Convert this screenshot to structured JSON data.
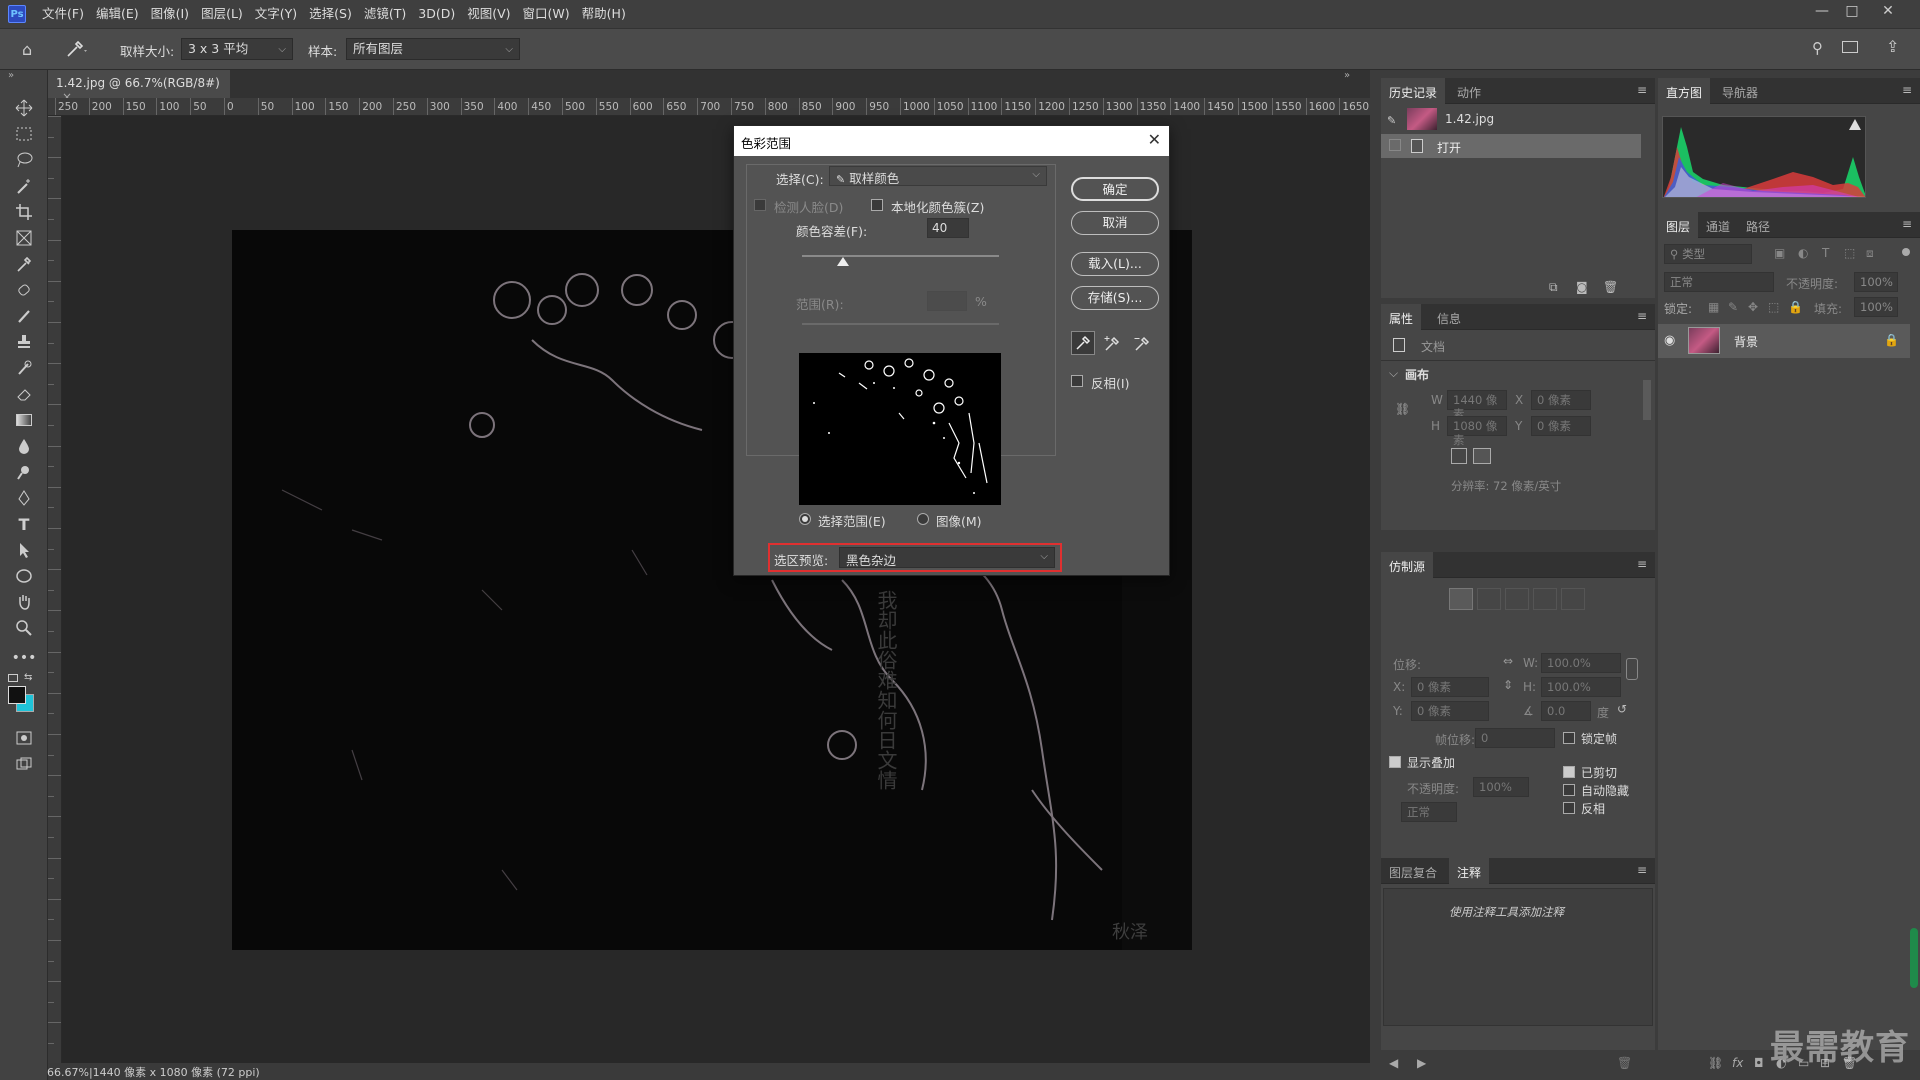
{
  "app": {
    "logo": "Ps"
  },
  "menu": [
    "文件(F)",
    "编辑(E)",
    "图像(I)",
    "图层(L)",
    "文字(Y)",
    "选择(S)",
    "滤镜(T)",
    "3D(D)",
    "视图(V)",
    "窗口(W)",
    "帮助(H)"
  ],
  "window_controls": {
    "minimize": "—",
    "maximize": "□",
    "close": "✕"
  },
  "options": {
    "sample_size_label": "取样大小:",
    "sample_size_value": "3 x 3 平均",
    "sample_label": "样本:",
    "sample_value": "所有图层"
  },
  "document": {
    "tab_title": "1.42.jpg @ 66.7%(RGB/8#)",
    "tab_close": "×",
    "ruler_ticks": [
      "250",
      "200",
      "150",
      "100",
      "50",
      "0",
      "50",
      "100",
      "150",
      "200",
      "250",
      "300",
      "350",
      "400",
      "450",
      "500",
      "550",
      "600",
      "650",
      "700",
      "750",
      "800",
      "850",
      "900",
      "950",
      "1000",
      "1050",
      "1100",
      "1150",
      "1200",
      "1250",
      "1300",
      "1350",
      "1400",
      "1450",
      "1500",
      "1550",
      "1600",
      "1650"
    ],
    "status": "66.67%|1440 像素 x 1080 像素 (72 ppi)",
    "image_text_column": [
      "我",
      "却",
      "此",
      "俗",
      "难",
      "知",
      "何",
      "日",
      "文",
      "情"
    ],
    "image_sign": "秋泽"
  },
  "dialog": {
    "title": "色彩范围",
    "close": "✕",
    "select_label": "选择(C):",
    "select_value": "取样颜色",
    "detect_faces": "检测人脸(D)",
    "localized": "本地化颜色簇(Z)",
    "fuzziness_label": "颜色容差(F):",
    "fuzziness_value": "40",
    "fuzziness_level": 0.21,
    "range_label": "范围(R):",
    "range_unit": "%",
    "radio_selection": "选择范围(E)",
    "radio_image": "图像(M)",
    "preview_label": "选区预览:",
    "preview_value": "黑色杂边",
    "buttons": {
      "ok": "确定",
      "cancel": "取消",
      "load": "载入(L)...",
      "save": "存储(S)..."
    },
    "invert": "反相(I)",
    "highlight_color": "#e03030"
  },
  "history_panel": {
    "tabs": [
      "历史记录",
      "动作"
    ],
    "items": [
      {
        "label": "1.42.jpg"
      },
      {
        "label": "打开"
      }
    ]
  },
  "properties_panel": {
    "tabs": [
      "属性",
      "信息"
    ],
    "doc_label": "文档",
    "section": "画布",
    "w_label": "W",
    "w_value": "1440 像素",
    "h_label": "H",
    "h_value": "1080 像素",
    "x_label": "X",
    "x_value": "0 像素",
    "y_label": "Y",
    "y_value": "0 像素",
    "resolution": "分辨率: 72 像素/英寸"
  },
  "clone_panel": {
    "tabs": [
      "仿制源"
    ],
    "offset_label": "位移:",
    "x_label": "X:",
    "x_value": "0 像素",
    "y_label": "Y:",
    "y_value": "0 像素",
    "w_label": "W:",
    "w_value": "100.0%",
    "h_label": "H:",
    "h_value": "100.0%",
    "angle_value": "0.0",
    "angle_unit": "度",
    "frame_offset_label": "帧位移:",
    "frame_offset_value": "0",
    "lock_frame": "锁定帧",
    "show_overlay": "显示叠加",
    "opacity_label": "不透明度:",
    "opacity_value": "100%",
    "mode_value": "正常",
    "clipped": "已剪切",
    "auto_hide": "自动隐藏",
    "invert": "反相"
  },
  "notes_panel": {
    "tabs": [
      "图层复合",
      "注释"
    ],
    "hint": "使用注释工具添加注释"
  },
  "histogram_panel": {
    "tabs": [
      "直方图",
      "导航器"
    ],
    "warning": "!"
  },
  "layers_panel": {
    "tabs": [
      "图层",
      "通道",
      "路径"
    ],
    "filter_label": "类型",
    "blend_mode": "正常",
    "opacity_label": "不透明度:",
    "opacity_value": "100%",
    "lock_label": "锁定:",
    "fill_label": "填充:",
    "fill_value": "100%",
    "layer_name": "背景"
  },
  "watermark": "最需教育"
}
